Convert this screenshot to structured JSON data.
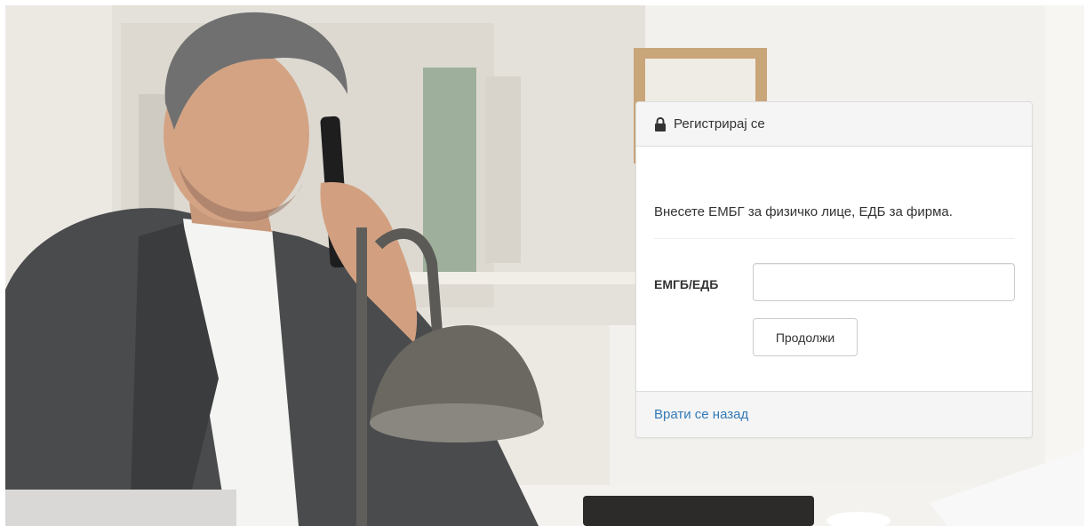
{
  "panel": {
    "title": "Регистрирај се",
    "lock_icon": "lock-icon",
    "instruction": "Внесете ЕМБГ за физичко лице, ЕДБ за фирма.",
    "field_label": "ЕМГБ/ЕДБ",
    "field_value": "",
    "continue_label": "Продолжи",
    "back_label": "Врати се назад",
    "link_color": "#337ab7"
  }
}
